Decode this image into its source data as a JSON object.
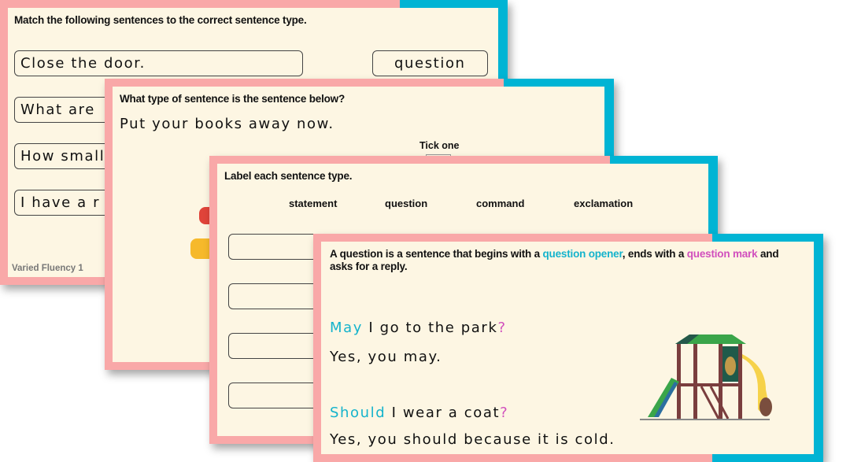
{
  "slide1": {
    "title": "Match the following sentences to the correct sentence type.",
    "sentences": [
      "Close the door.",
      "What are",
      "How small",
      "I have a r"
    ],
    "type_box": "question",
    "footer": "Varied Fluency 1"
  },
  "slide2": {
    "title": "What type of sentence is the sentence below?",
    "sentence": "Put your books away now.",
    "tick_label": "Tick one"
  },
  "slide3": {
    "title": "Label each sentence type.",
    "labels": [
      "statement",
      "question",
      "command",
      "exclamation"
    ]
  },
  "slide4": {
    "def": {
      "p1": "A question is a sentence that begins with a ",
      "k1": "question opener",
      "p2": ", ends with a ",
      "k2": "question mark",
      "p3": " and asks for a reply."
    },
    "q1": {
      "opener": "May",
      "rest": " I go to the park",
      "mark": "?"
    },
    "a1": "Yes, you may.",
    "q2": {
      "opener": "Should",
      "rest": " I wear a coat",
      "mark": "?"
    },
    "a2": "Yes, you should because it is cold."
  },
  "colors": {
    "pink_frame": "#f9a8a8",
    "teal_frame": "#00b4d4",
    "cream": "#fdf6e3",
    "opener": "#14b3cc",
    "mark": "#d14fbd"
  },
  "icons": [
    "playground-icon",
    "pencil-icon"
  ]
}
